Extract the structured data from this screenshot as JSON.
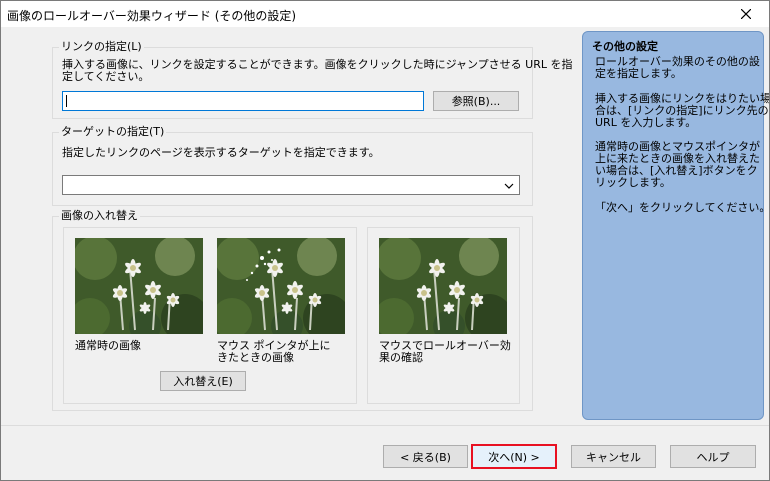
{
  "window": {
    "title": "画像のロールオーバー効果ウィザード (その他の設定)"
  },
  "link_section": {
    "label": "リンクの指定(L)",
    "desc_line1": "挿入する画像に、リンクを設定することができます。画像をクリックした時にジャンプさせる URL を指",
    "desc_line2": "定してください。",
    "url_value": "",
    "browse_button": "参照(B)..."
  },
  "target_section": {
    "label": "ターゲットの指定(T)",
    "desc": "指定したリンクのページを表示するターゲットを指定できます。",
    "selected_value": ""
  },
  "image_section": {
    "label": "画像の入れ替え",
    "normal_caption": "通常時の画像",
    "hover_caption_line1": "マウス ポインタが上に",
    "hover_caption_line2": "きたときの画像",
    "swap_button": "入れ替え(E)",
    "preview_caption_line1": "マウスでロールオーバー効",
    "preview_caption_line2": "果の確認"
  },
  "help_panel": {
    "heading": "その他の設定",
    "p1_line1": "ロールオーバー効果のその他の設",
    "p1_line2": "定を指定します。",
    "p2_line1": "挿入する画像にリンクをはりたい場",
    "p2_line2": "合は、[リンクの指定]にリンク先の",
    "p2_line3": "URL を入力します。",
    "p3_line1": "通常時の画像とマウスポインタが",
    "p3_line2": "上に来たときの画像を入れ替えた",
    "p3_line3": "い場合は、[入れ替え]ボタンをク",
    "p3_line4": "リックします。",
    "p4": "「次へ」をクリックしてください。"
  },
  "footer": {
    "back": "< 戻る(B)",
    "next": "次へ(N) >",
    "cancel": "キャンセル",
    "help": "ヘルプ"
  },
  "colors": {
    "help_bg": "#98b8e0",
    "focus_border": "#e81123",
    "input_focus": "#0078d7"
  }
}
